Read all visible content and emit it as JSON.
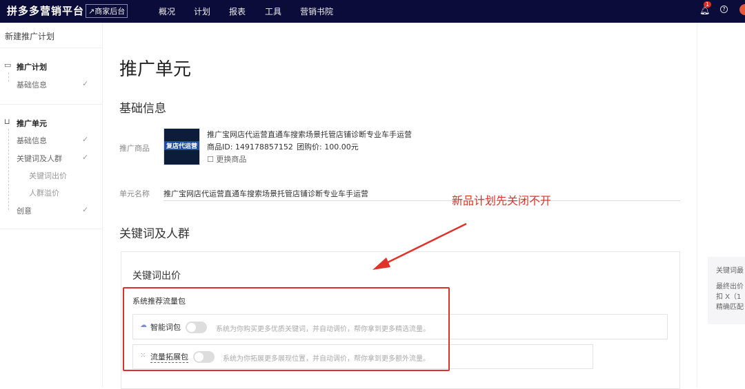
{
  "header": {
    "logo": "拼多多营销平台",
    "merchant_link": "↗商家后台",
    "nav": [
      "概况",
      "计划",
      "报表",
      "工具",
      "营销书院"
    ],
    "notification_count": "1",
    "help": "?"
  },
  "sidebar": {
    "title": "新建推广计划",
    "group1": {
      "label": "推广计划",
      "items": [
        {
          "label": "基础信息",
          "check": "✓"
        }
      ]
    },
    "group2": {
      "label": "推广单元",
      "items": [
        {
          "label": "基础信息",
          "check": "✓"
        },
        {
          "label": "关键词及人群",
          "check": "✓"
        },
        {
          "label": "关键词出价"
        },
        {
          "label": "人群溢价"
        },
        {
          "label": "创意",
          "check": "✓"
        }
      ]
    }
  },
  "main": {
    "title": "推广单元",
    "basic_info": "基础信息",
    "product_label": "推广商品",
    "product_name": "推广宝网店代运营直通车搜索场景托管店铺诊断专业车手运营",
    "product_id": "商品ID: 149178857152",
    "group_price": "团购价: 100.00元",
    "change_product": "更换商品",
    "thumb_text": "复店代运营",
    "unit_name_label": "单元名称",
    "unit_name": "推广宝网店代运营直通车搜索场景托管店铺诊断专业车手运营",
    "keywords_section": "关键词及人群",
    "keyword_bid": "关键词出价",
    "traffic_pack": "系统推荐流量包",
    "packs": [
      {
        "name": "智能词包",
        "enabled": false,
        "desc": "系统为你购买更多优质关键词，并自动调价，帮你拿到更多精选流量。"
      },
      {
        "name": "流量拓展包",
        "enabled": false,
        "desc": "系统为你拓展更多展现位置，并自动调价，帮你拿到更多额外流量。"
      }
    ]
  },
  "annotation": "新品计划先关闭不开",
  "right_panel": {
    "title": "关键词最",
    "lines": [
      "最终出价",
      "扣 X（1",
      "精确匹配"
    ]
  },
  "colors": {
    "topbar": "#0c0c3a",
    "annotation": "#e0312b"
  }
}
